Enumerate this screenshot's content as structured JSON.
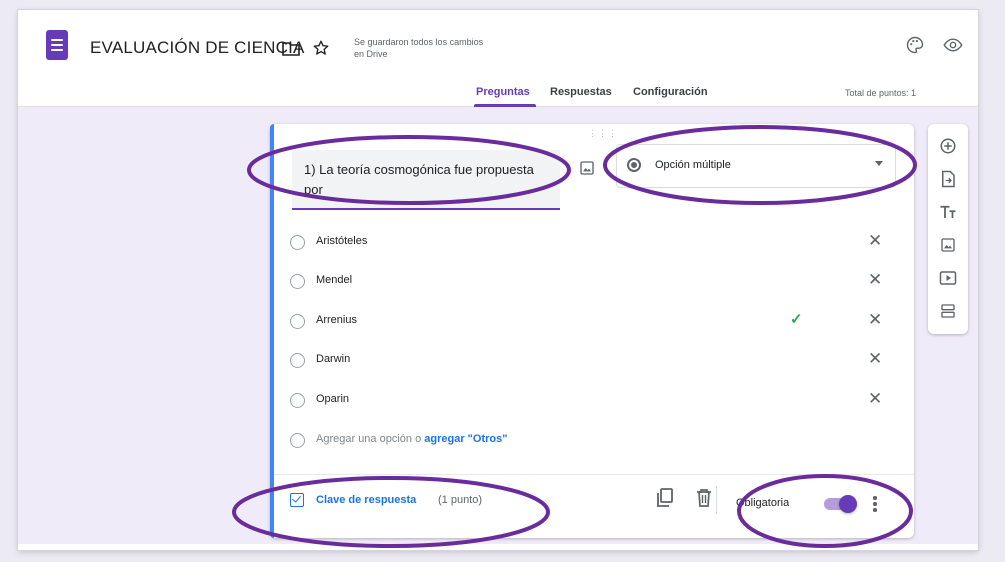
{
  "header": {
    "title": "EVALUACIÓN DE CIENCIA",
    "saved_status": "Se guardaron todos los cambios en Drive",
    "icons": [
      "form-icon",
      "folder-icon",
      "star-icon",
      "palette-icon",
      "preview-eye-icon"
    ],
    "tabs": [
      {
        "label": "Preguntas",
        "active": true
      },
      {
        "label": "Respuestas",
        "active": false
      },
      {
        "label": "Configuración",
        "active": false
      }
    ],
    "total_points": "Total de puntos: 1"
  },
  "question": {
    "title": "1) La teoría cosmogónica fue propuesta por",
    "type_label": "Opción múltiple",
    "options": [
      {
        "label": "Aristóteles",
        "correct": false
      },
      {
        "label": "Mendel",
        "correct": false
      },
      {
        "label": "Arrenius",
        "correct": true
      },
      {
        "label": "Darwin",
        "correct": false
      },
      {
        "label": "Oparin",
        "correct": false
      }
    ],
    "add_option": "Agregar una opción",
    "or_word": "o",
    "add_other": "agregar \"Otros\"",
    "answer_key_label": "Clave de respuesta",
    "answer_key_points": "(1 punto)",
    "required_label": "Obligatoria",
    "required_on": true
  },
  "colors": {
    "accent": "#673ab7",
    "highlight_ring": "#6a2c9c",
    "link": "#1a73e8",
    "correct": "#34a853"
  },
  "side_toolbar": [
    "add-question-icon",
    "import-questions-icon",
    "title-text-icon",
    "add-image-icon",
    "add-video-icon",
    "add-section-icon"
  ]
}
